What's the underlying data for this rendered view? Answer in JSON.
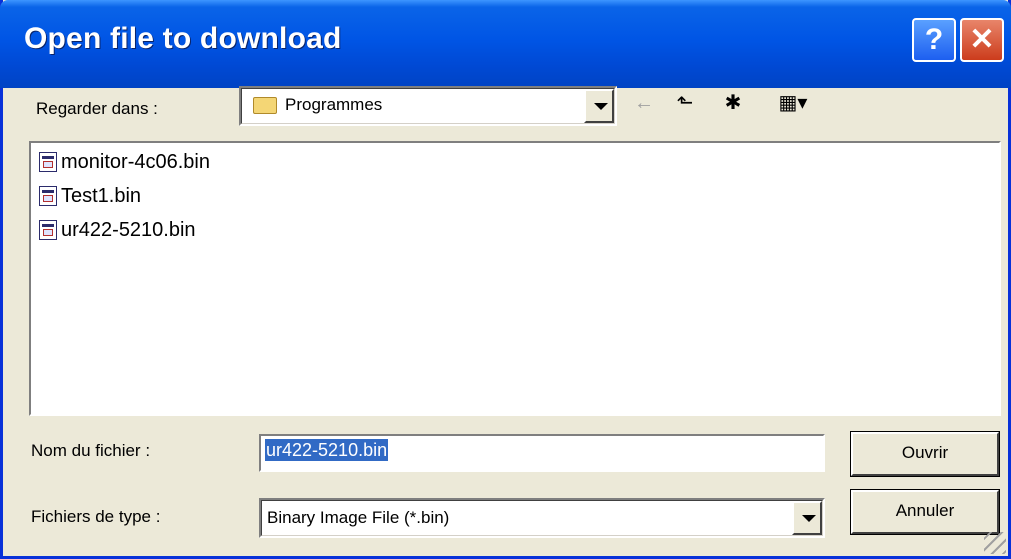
{
  "window": {
    "title": "Open file to download"
  },
  "titlebar": {
    "help_icon": "?",
    "close_icon": "✕"
  },
  "lookin": {
    "label": "Regarder dans :",
    "value": "Programmes"
  },
  "toolbar": {
    "back_icon": "←",
    "up_icon": "⬑",
    "newfolder_icon": "✱",
    "views_icon": "▦▾"
  },
  "files": [
    {
      "name": "monitor-4c06.bin"
    },
    {
      "name": "Test1.bin"
    },
    {
      "name": "ur422-5210.bin"
    }
  ],
  "filename": {
    "label": "Nom du fichier :",
    "value": "ur422-5210.bin"
  },
  "filetype": {
    "label": "Fichiers de type :",
    "value": "Binary Image File (*.bin)"
  },
  "buttons": {
    "open": "Ouvrir",
    "cancel": "Annuler"
  }
}
